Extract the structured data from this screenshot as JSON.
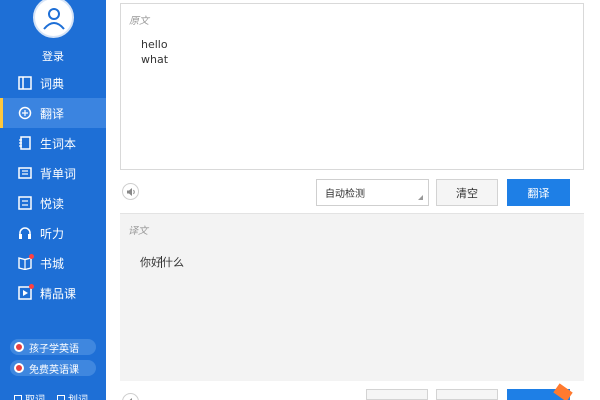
{
  "sidebar": {
    "login_label": "登录",
    "items": [
      {
        "label": "词典",
        "icon": "book-icon",
        "active": false
      },
      {
        "label": "翻译",
        "icon": "translate-icon",
        "active": true
      },
      {
        "label": "生词本",
        "icon": "notebook-icon",
        "active": false
      },
      {
        "label": "背单词",
        "icon": "flashcard-icon",
        "active": false
      },
      {
        "label": "悦读",
        "icon": "reading-icon",
        "active": false
      },
      {
        "label": "听力",
        "icon": "headphones-icon",
        "active": false
      },
      {
        "label": "书城",
        "icon": "bookstore-icon",
        "active": false
      },
      {
        "label": "精品课",
        "icon": "video-course-icon",
        "active": false
      }
    ],
    "promos": [
      {
        "label": "孩子学英语"
      },
      {
        "label": "免费英语课"
      }
    ],
    "bottom_checks": [
      {
        "label": "取词"
      },
      {
        "label": "划词"
      }
    ]
  },
  "source": {
    "label": "原文",
    "text": "hello\nwhat"
  },
  "controls": {
    "language_select": "自动检测",
    "clear_label": "清空",
    "translate_label": "翻译"
  },
  "result": {
    "label": "译文",
    "text_before_caret": "你好",
    "text_after_caret": "什么"
  },
  "colors": {
    "sidebar_bg": "#1e6fd6",
    "accent": "#1e7fe6",
    "active_marker": "#ffc83d"
  }
}
